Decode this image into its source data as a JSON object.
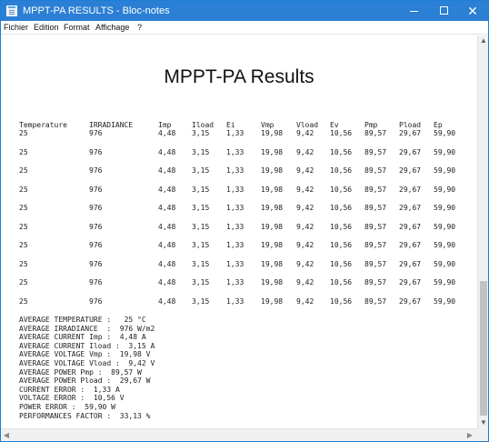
{
  "window": {
    "title": "MPPT-PA RESULTS - Bloc-notes",
    "minimize": "—",
    "close": "✕"
  },
  "menu": [
    "Fichier",
    "Edition",
    "Format",
    "Affichage",
    "?"
  ],
  "document": {
    "heading": "MPPT-PA Results",
    "columns": [
      "Temperature",
      "IRRADIANCE",
      "Imp",
      "Iload",
      "Ei",
      "Vmp",
      "Vload",
      "Ev",
      "Pmp",
      "Pload",
      "Ep"
    ],
    "rows": [
      [
        "25",
        "976",
        "4,48",
        "3,15",
        "1,33",
        "19,98",
        "9,42",
        "10,56",
        "89,57",
        "29,67",
        "59,90"
      ],
      [
        "25",
        "976",
        "4,48",
        "3,15",
        "1,33",
        "19,98",
        "9,42",
        "10,56",
        "89,57",
        "29,67",
        "59,90"
      ],
      [
        "25",
        "976",
        "4,48",
        "3,15",
        "1,33",
        "19,98",
        "9,42",
        "10,56",
        "89,57",
        "29,67",
        "59,90"
      ],
      [
        "25",
        "976",
        "4,48",
        "3,15",
        "1,33",
        "19,98",
        "9,42",
        "10,56",
        "89,57",
        "29,67",
        "59,90"
      ],
      [
        "25",
        "976",
        "4,48",
        "3,15",
        "1,33",
        "19,98",
        "9,42",
        "10,56",
        "89,57",
        "29,67",
        "59,90"
      ],
      [
        "25",
        "976",
        "4,48",
        "3,15",
        "1,33",
        "19,98",
        "9,42",
        "10,56",
        "89,57",
        "29,67",
        "59,90"
      ],
      [
        "25",
        "976",
        "4,48",
        "3,15",
        "1,33",
        "19,98",
        "9,42",
        "10,56",
        "89,57",
        "29,67",
        "59,90"
      ],
      [
        "25",
        "976",
        "4,48",
        "3,15",
        "1,33",
        "19,98",
        "9,42",
        "10,56",
        "89,57",
        "29,67",
        "59,90"
      ],
      [
        "25",
        "976",
        "4,48",
        "3,15",
        "1,33",
        "19,98",
        "9,42",
        "10,56",
        "89,57",
        "29,67",
        "59,90"
      ],
      [
        "25",
        "976",
        "4,48",
        "3,15",
        "1,33",
        "19,98",
        "9,42",
        "10,56",
        "89,57",
        "29,67",
        "59,90"
      ]
    ],
    "summary": [
      "AVERAGE TEMPERATURE :   25 °C",
      "AVERAGE IRRADIANCE  :  976 W/m2",
      "AVERAGE CURRENT Imp :  4,48 A",
      "AVERAGE CURRENT Iload :  3,15 A",
      "AVERAGE VOLTAGE Vmp :  19,98 V",
      "AVERAGE VOLTAGE Vload :  9,42 V",
      "AVERAGE POWER Pmp :  89,57 W",
      "AVERAGE POWER Pload :  29,67 W",
      "CURRENT ERROR :  1,33 A",
      "VOLTAGE ERROR :  10,56 V",
      "POWER ERROR :  59,90 W",
      "PERFORMANCES FACTOR :  33,13 %"
    ]
  },
  "colors": {
    "titlebar": "#2b7fd4",
    "background": "#ffffff",
    "scrollbar_thumb": "#c2c2c2"
  }
}
